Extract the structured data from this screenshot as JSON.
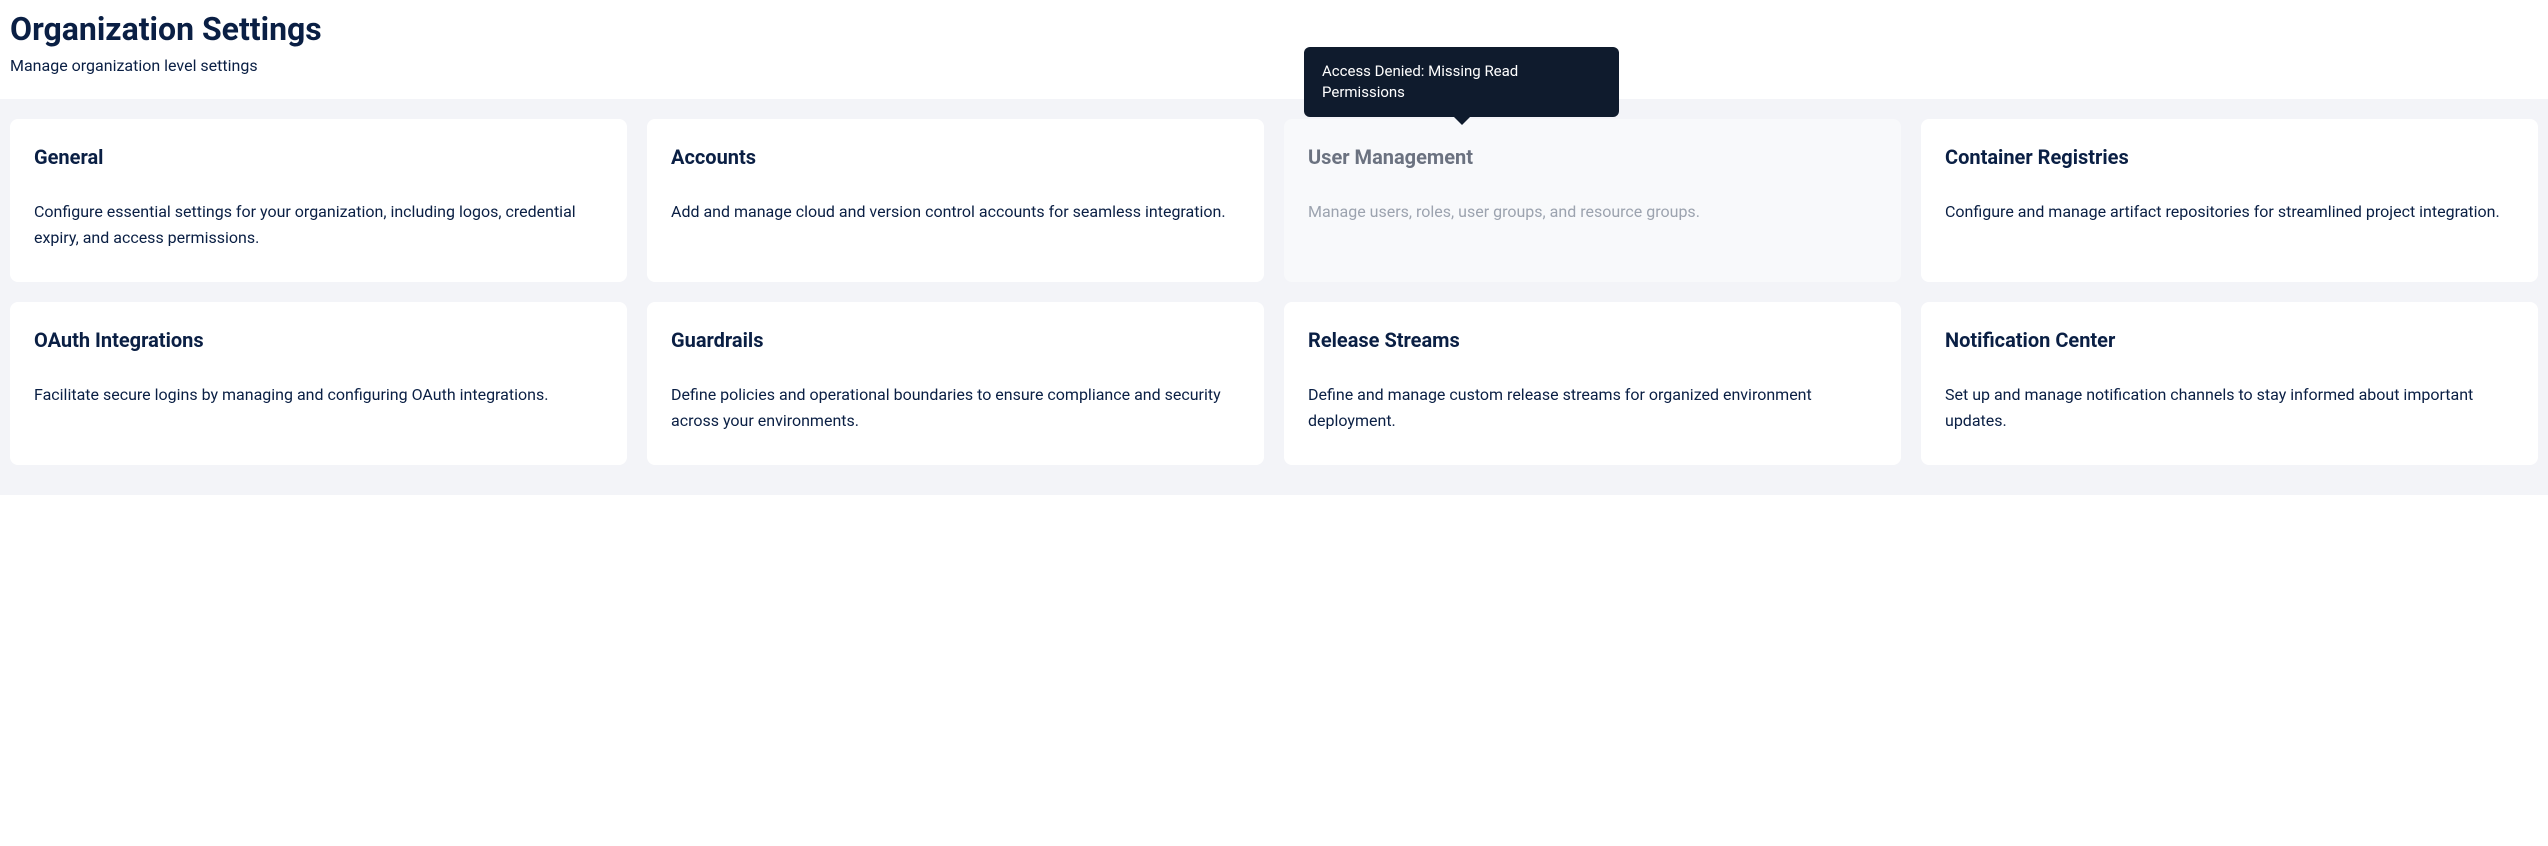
{
  "header": {
    "title": "Organization Settings",
    "subtitle": "Manage organization level settings"
  },
  "tooltip": {
    "text": "Access Denied: Missing Read Permissions"
  },
  "cards": [
    {
      "title": "General",
      "description": "Configure essential settings for your organization, including logos, credential expiry, and access permissions.",
      "disabled": false
    },
    {
      "title": "Accounts",
      "description": "Add and manage cloud and version control accounts for seamless integration.",
      "disabled": false
    },
    {
      "title": "User Management",
      "description": "Manage users, roles, user groups, and resource groups.",
      "disabled": true
    },
    {
      "title": "Container Registries",
      "description": "Configure and manage artifact repositories for streamlined project integration.",
      "disabled": false
    },
    {
      "title": "OAuth Integrations",
      "description": "Facilitate secure logins by managing and configuring OAuth integrations.",
      "disabled": false
    },
    {
      "title": "Guardrails",
      "description": "Define policies and operational boundaries to ensure compliance and security across your environments.",
      "disabled": false
    },
    {
      "title": "Release Streams",
      "description": "Define and manage custom release streams for organized environment deployment.",
      "disabled": false
    },
    {
      "title": "Notification Center",
      "description": "Set up and manage notification channels to stay informed about important updates.",
      "disabled": false
    }
  ]
}
